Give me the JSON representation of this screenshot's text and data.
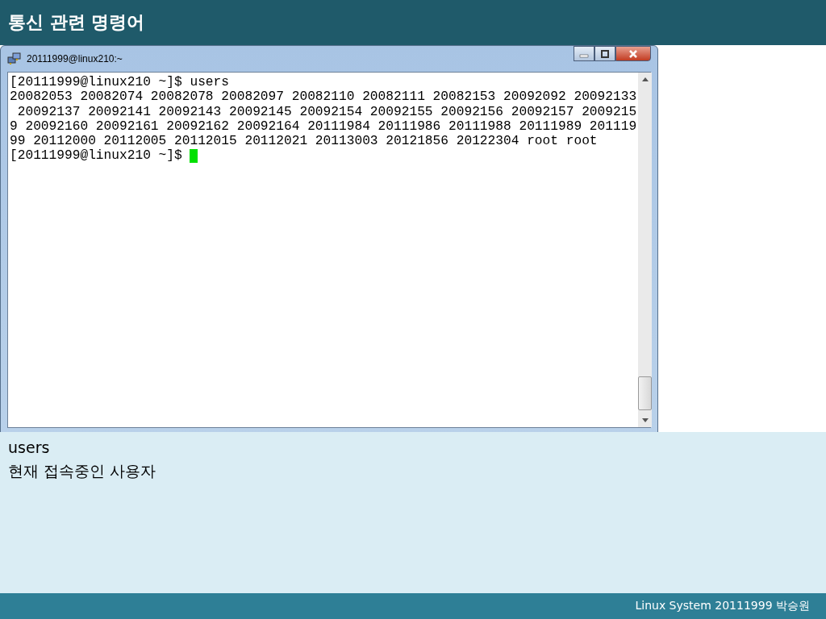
{
  "slide_title": "통신 관련 명령어",
  "window": {
    "title": "20111999@linux210:~"
  },
  "terminal": {
    "lines": [
      "[20111999@linux210 ~]$ users",
      "20082053 20082074 20082078 20082097 20082110 20082111 20082153 20092092 20092133",
      " 20092137 20092141 20092143 20092145 20092154 20092155 20092156 20092157 2009215",
      "9 20092160 20092161 20092162 20092164 20111984 20111986 20111988 20111989 201119",
      "99 20112000 20112005 20112015 20112021 20113003 20121856 20122304 root root",
      "[20111999@linux210 ~]$ "
    ],
    "cursor": true
  },
  "description": [
    "users",
    "현재 접속중인 사용자"
  ],
  "footer": "Linux System 20111999 박승원"
}
